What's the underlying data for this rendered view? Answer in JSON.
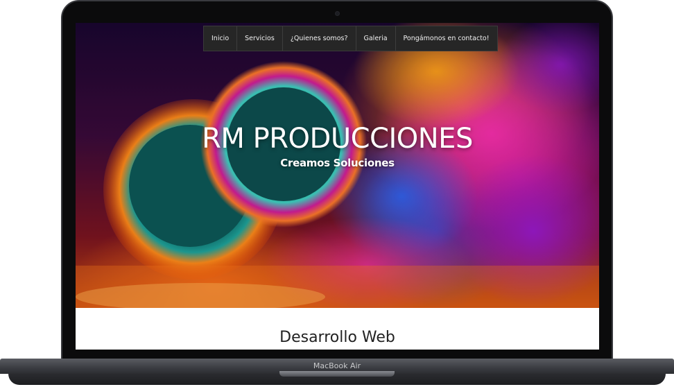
{
  "nav": {
    "items": [
      {
        "label": "Inicio"
      },
      {
        "label": "Servicios"
      },
      {
        "label": "¿Quienes somos?"
      },
      {
        "label": "Galeria"
      },
      {
        "label": "Pongámonos en contacto!"
      }
    ]
  },
  "hero": {
    "title": "RM PRODUCCIONES",
    "subtitle": "Creamos Soluciones"
  },
  "section": {
    "title": "Desarrollo Web"
  },
  "device": {
    "label": "MacBook Air"
  },
  "colors": {
    "navbar_bg": "#262626",
    "nav_text": "#f2f2f2",
    "hero_text": "#ffffff",
    "section_text": "#222222"
  }
}
